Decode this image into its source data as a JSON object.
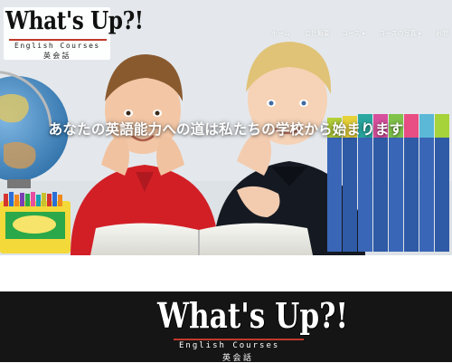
{
  "brand": {
    "name": "What's Up?!",
    "tagline": "English Courses",
    "japanese": "英 会 話"
  },
  "nav": {
    "items": [
      {
        "label": "ホーム"
      },
      {
        "label": "会社概要"
      },
      {
        "label": "コース"
      },
      {
        "label": "コースの写真"
      },
      {
        "label": "お問"
      }
    ]
  },
  "hero": {
    "headline": "あなたの英語能力への道は私たちの学校から始まります"
  },
  "footer": {
    "brand_name": "What's Up?!",
    "tagline": "English Courses",
    "japanese": "英 会 話"
  },
  "colors": {
    "accent": "#c0392b",
    "footer_bg": "#151515",
    "nav_text": "#ffffff"
  }
}
